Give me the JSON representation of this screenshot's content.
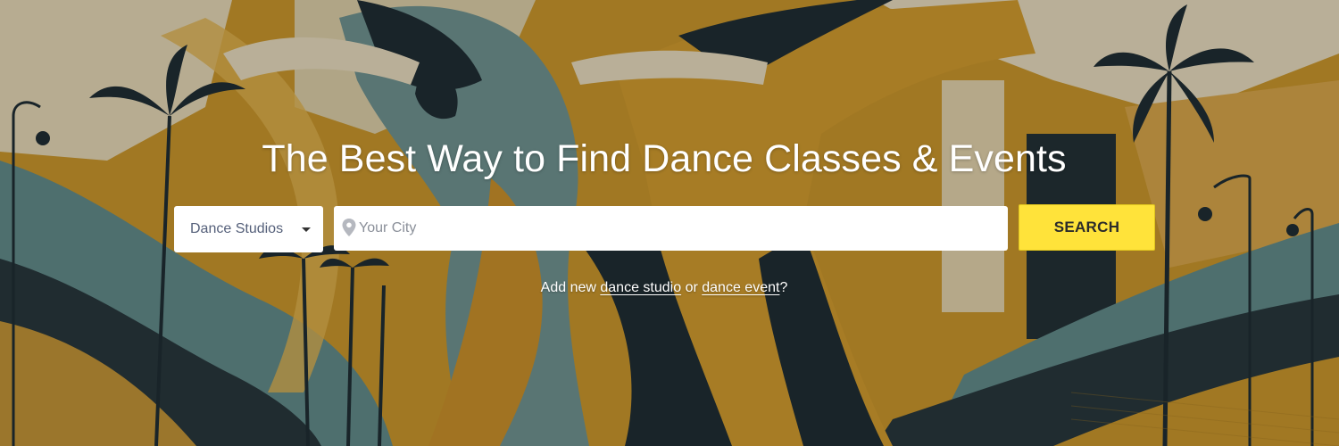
{
  "hero": {
    "title": "The Best Way to Find Dance Classes & Events",
    "background_icon": "dance-couple-illustration"
  },
  "search": {
    "category_selected": "Dance Studios",
    "city_placeholder": "Your City",
    "city_value": "",
    "pin_icon": "map-pin-icon",
    "button_label": "SEARCH",
    "button_color": "#ffe33a"
  },
  "add_links": {
    "prefix": "Add new",
    "studio_link": "dance studio",
    "middle": "or",
    "event_link": "dance event",
    "suffix": "?"
  },
  "colors": {
    "mustard": "#c9952b",
    "teal": "#5f8a8b",
    "navy": "#1c2a33",
    "cream": "#e8dcc0"
  }
}
